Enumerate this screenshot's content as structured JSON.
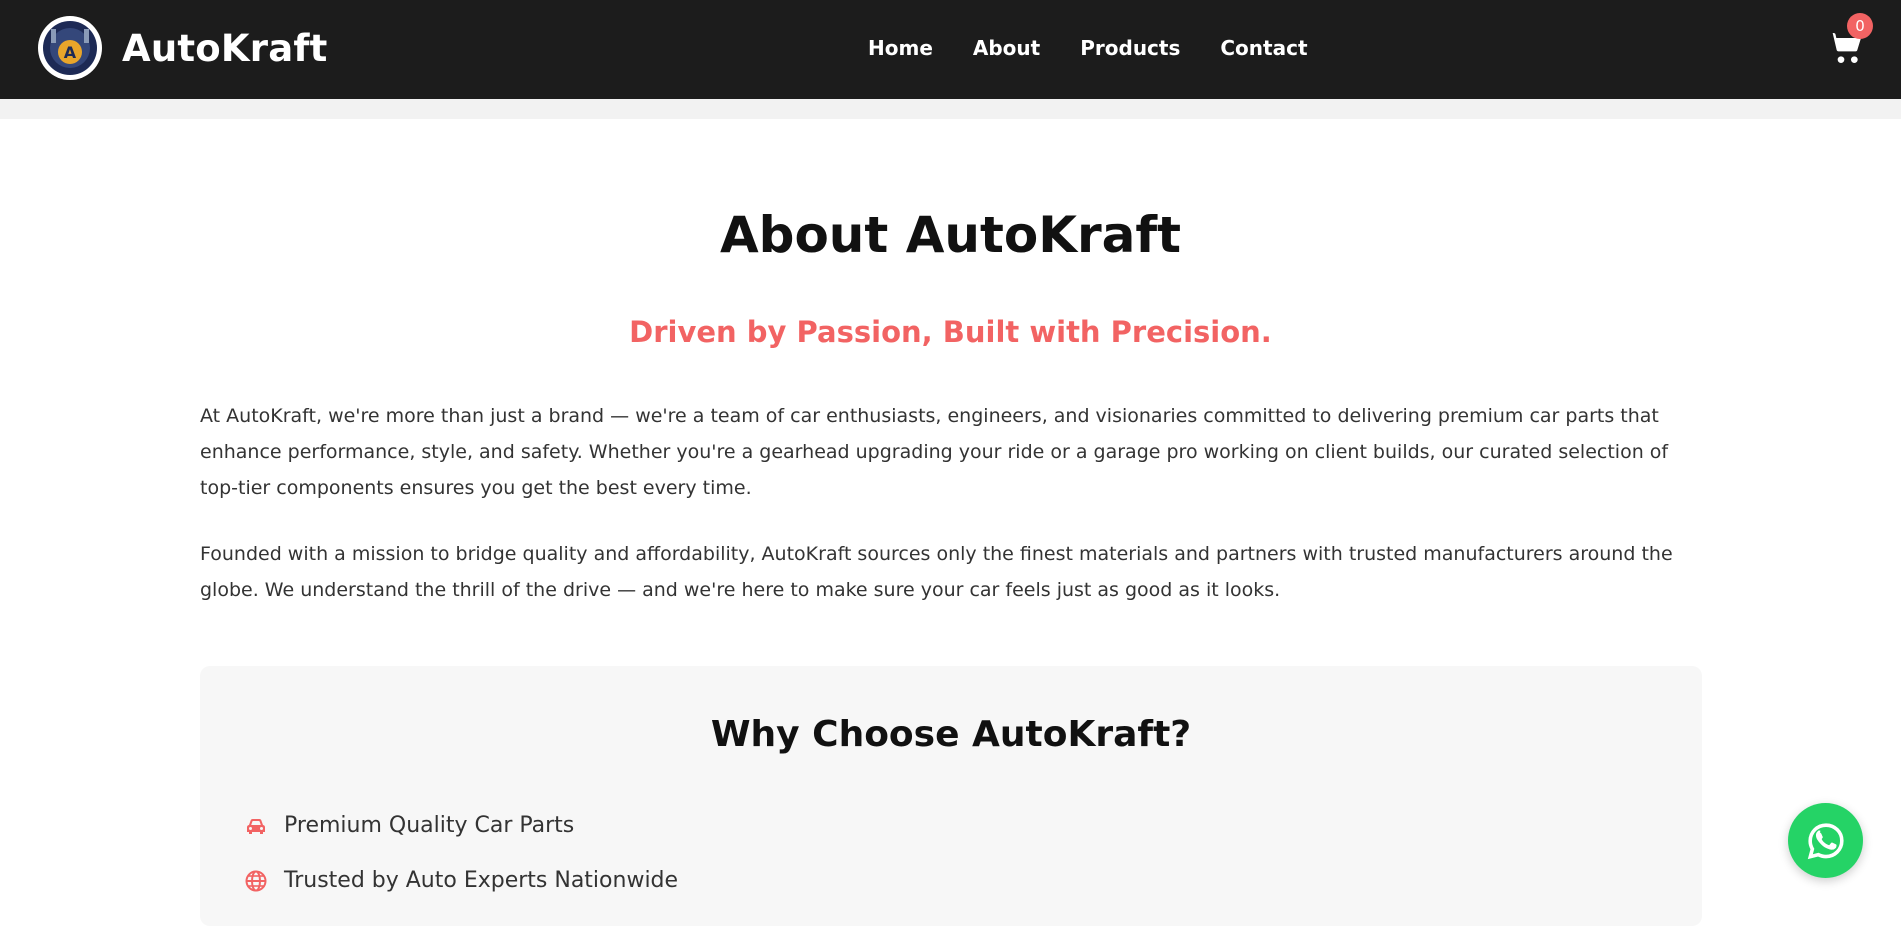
{
  "header": {
    "brand": "AutoKraft",
    "logo_letter": "A",
    "nav": [
      {
        "label": "Home"
      },
      {
        "label": "About"
      },
      {
        "label": "Products"
      },
      {
        "label": "Contact"
      }
    ],
    "cart": {
      "icon": "cart-icon",
      "count": "0"
    }
  },
  "about": {
    "title": "About AutoKraft",
    "tagline": "Driven by Passion, Built with Precision.",
    "paragraphs": [
      "At AutoKraft, we're more than just a brand — we're a team of car enthusiasts, engineers, and visionaries committed to delivering premium car parts that enhance performance, style, and safety. Whether you're a gearhead upgrading your ride or a garage pro working on client builds, our curated selection of top-tier components ensures you get the best every time.",
      "Founded with a mission to bridge quality and affordability, AutoKraft sources only the finest materials and partners with trusted manufacturers around the globe. We understand the thrill of the drive — and we're here to make sure your car feels just as good as it looks."
    ]
  },
  "why": {
    "title": "Why Choose AutoKraft?",
    "items": [
      {
        "icon": "car-icon",
        "label": "Premium Quality Car Parts"
      },
      {
        "icon": "globe-icon",
        "label": "Trusted by Auto Experts Nationwide"
      }
    ]
  },
  "colors": {
    "accent": "#f26363",
    "header_bg": "#1c1c1c",
    "whatsapp": "#25d366"
  },
  "floating": {
    "icon": "whatsapp-icon"
  }
}
